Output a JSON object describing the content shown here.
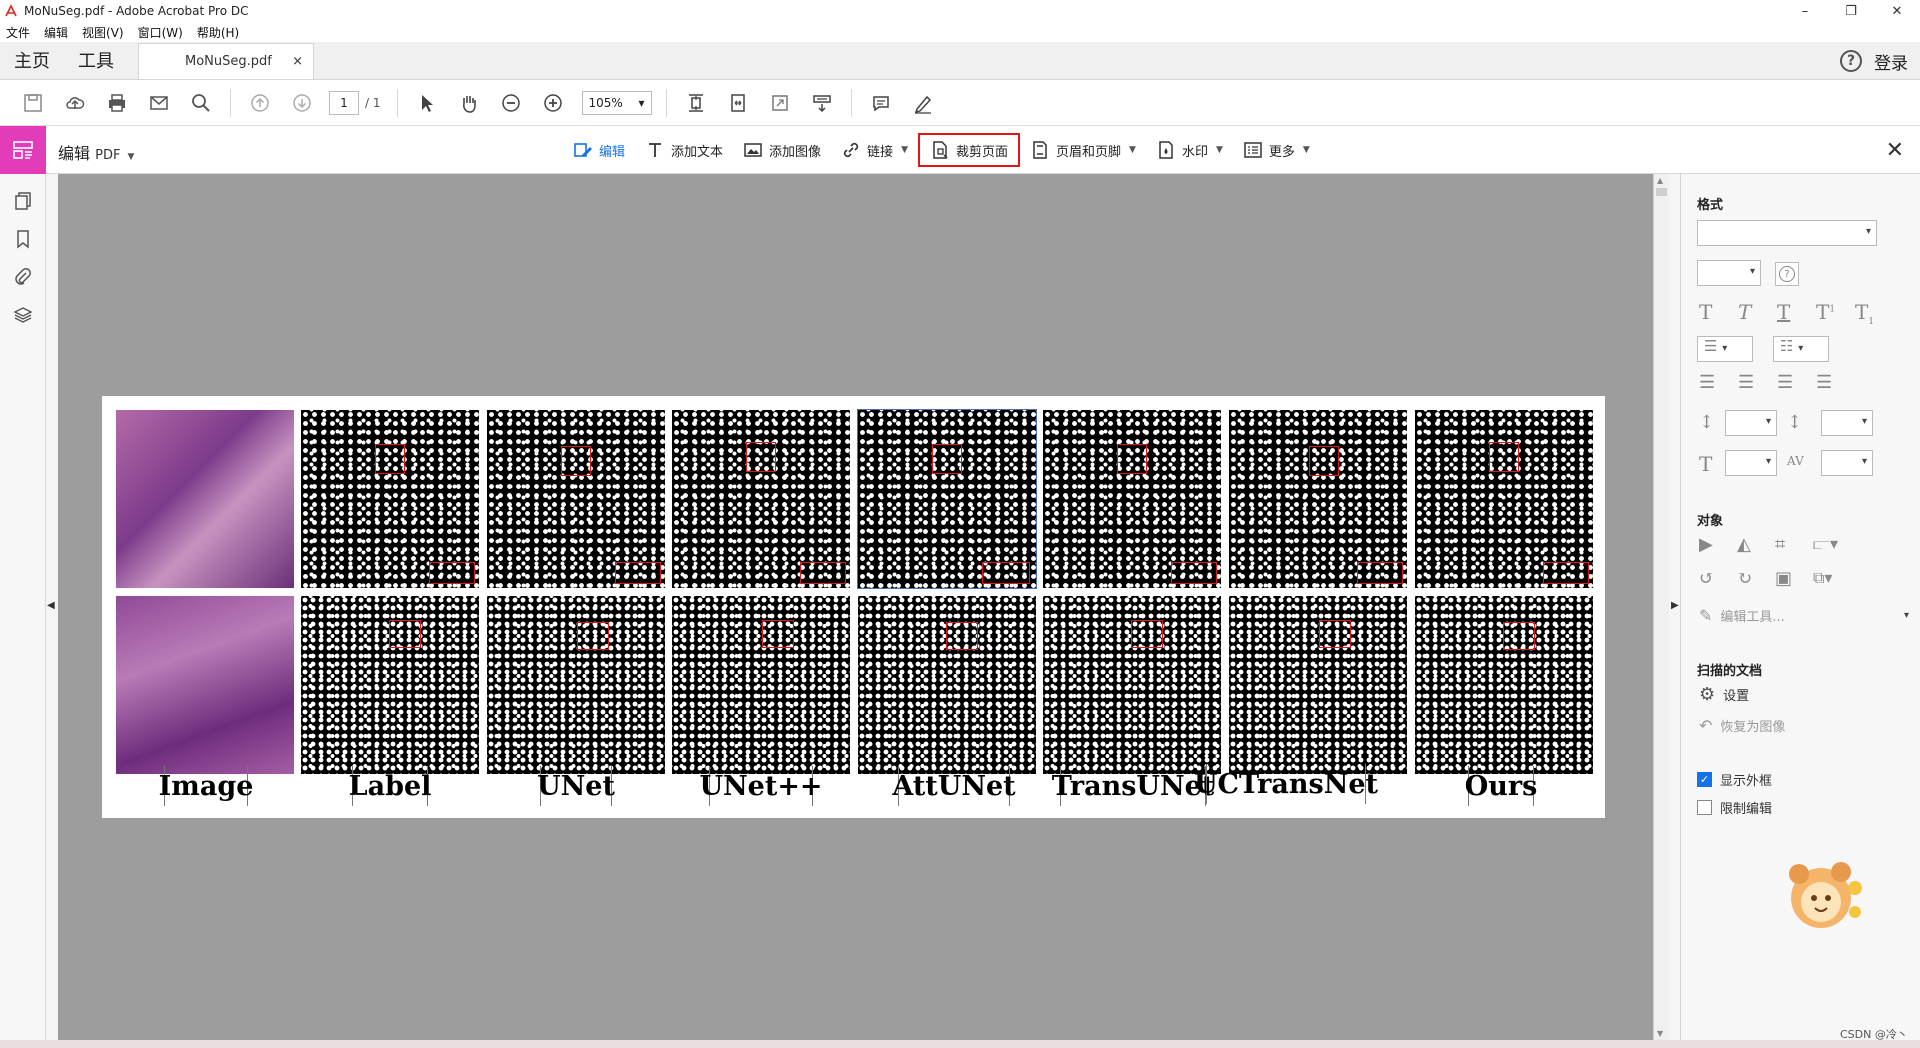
{
  "window": {
    "title": "MoNuSeg.pdf - Adobe Acrobat Pro DC",
    "controls": [
      "–",
      "❐",
      "✕"
    ]
  },
  "menu": [
    "文件",
    "编辑",
    "视图(V)",
    "窗口(W)",
    "帮助(H)"
  ],
  "tabs": {
    "home": "主页",
    "tools": "工具",
    "document": "MoNuSeg.pdf",
    "close": "×",
    "login": "登录",
    "help": "?"
  },
  "toolbar": {
    "page_current": "1",
    "page_total": "/ 1",
    "zoom": "105%"
  },
  "edit_bar": {
    "mode_label": "编辑",
    "mode_suffix": "PDF",
    "tools": {
      "edit": "编辑",
      "add_text": "添加文本",
      "add_image": "添加图像",
      "link": "链接",
      "crop": "裁剪页面",
      "header_footer": "页眉和页脚",
      "watermark": "水印",
      "more": "更多"
    },
    "close": "✕"
  },
  "figure": {
    "labels": [
      "Image",
      "Label",
      "UNet",
      "UNet++",
      "AttUNet",
      "TransUNet",
      "UCTransNet",
      "Ours"
    ]
  },
  "right_panel": {
    "format_heading": "格式",
    "object_heading": "对象",
    "edit_tools": "编辑工具...",
    "scanned_heading": "扫描的文档",
    "settings": "设置",
    "restore_image": "恢复为图像",
    "show_bbox": "显示外框",
    "restrict_edit": "限制编辑",
    "show_bbox_checked": true,
    "restrict_edit_checked": false
  },
  "watermark_text": "CSDN @冷丶",
  "colors": {
    "accent": "#1473e6",
    "highlight": "#e0161b",
    "mode_icon": "#e33cb8"
  }
}
